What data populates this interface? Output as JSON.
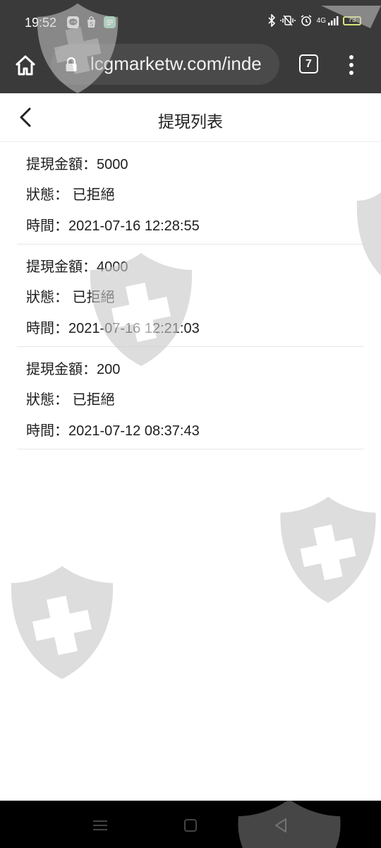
{
  "status_bar": {
    "time": "19:52",
    "network": "4G",
    "battery": "73",
    "notifications": [
      "line-icon",
      "shopping-bag-icon",
      "message-icon"
    ],
    "system_icons": [
      "bluetooth-icon",
      "vibrate-icon",
      "alarm-icon",
      "signal-icon",
      "battery-icon"
    ]
  },
  "browser": {
    "url": "lcgmarketw.com/inde",
    "tab_count": "7"
  },
  "header": {
    "title": "提現列表"
  },
  "records": [
    {
      "amount_label": "提現金額：",
      "amount": "5000",
      "status_label": "狀態：",
      "status": "已拒絕",
      "time_label": "時間：",
      "time": "2021-07-16 12:28:55"
    },
    {
      "amount_label": "提現金額：",
      "amount": "4000",
      "status_label": "狀態：",
      "status": "已拒絕",
      "time_label": "時間：",
      "time": "2021-07-16 12:21:03"
    },
    {
      "amount_label": "提現金額：",
      "amount": "200",
      "status_label": "狀態：",
      "status": "已拒絕",
      "time_label": "時間：",
      "time": "2021-07-12 08:37:43"
    }
  ],
  "colors": {
    "browser_bar": "#3a3a3a",
    "url_box": "#4a4a4a",
    "battery": "#d9e27a",
    "watermark": "#c8c8c8"
  }
}
